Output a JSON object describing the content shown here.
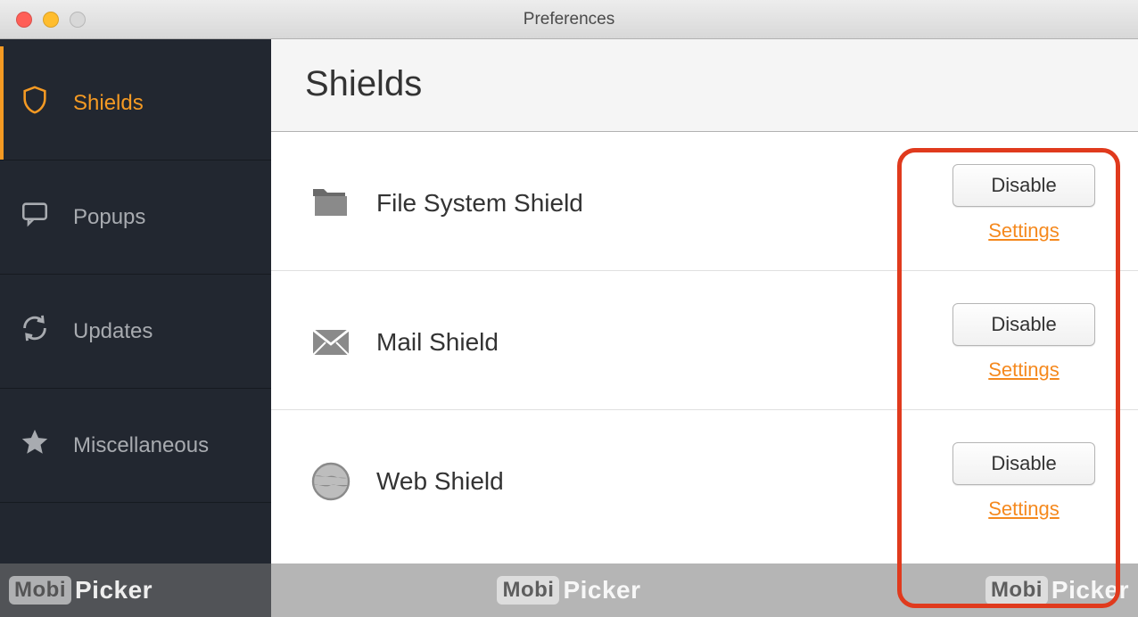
{
  "window": {
    "title": "Preferences"
  },
  "sidebar": {
    "items": [
      {
        "id": "shields",
        "label": "Shields",
        "active": true
      },
      {
        "id": "popups",
        "label": "Popups",
        "active": false
      },
      {
        "id": "updates",
        "label": "Updates",
        "active": false
      },
      {
        "id": "misc",
        "label": "Miscellaneous",
        "active": false
      }
    ]
  },
  "main": {
    "heading": "Shields",
    "shields": [
      {
        "icon": "folder",
        "label": "File System Shield",
        "button": "Disable",
        "link": "Settings"
      },
      {
        "icon": "mail",
        "label": "Mail Shield",
        "button": "Disable",
        "link": "Settings"
      },
      {
        "icon": "globe",
        "label": "Web Shield",
        "button": "Disable",
        "link": "Settings"
      }
    ]
  },
  "watermark": {
    "brand_box": "Mobi",
    "brand_text": "Picker"
  },
  "colors": {
    "accent": "#f59a23",
    "highlight": "#e03a1d"
  }
}
